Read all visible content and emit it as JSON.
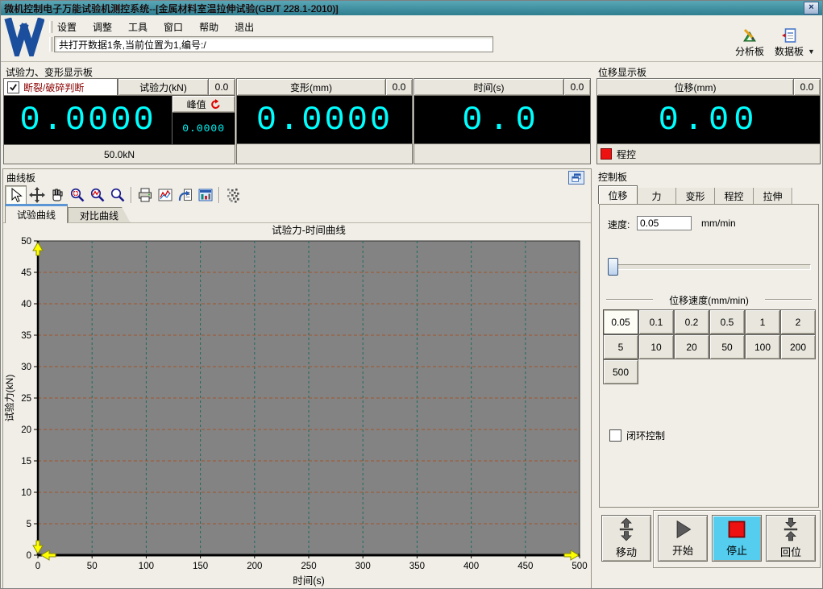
{
  "window": {
    "title": "微机控制电子万能试验机测控系统--[金属材料室温拉伸试验(GB/T 228.1-2010)]",
    "close_glyph": "×"
  },
  "menu": {
    "items": [
      "设置",
      "调整",
      "工具",
      "窗口",
      "帮助",
      "退出"
    ]
  },
  "statusbar": {
    "text": "共打开数据1条,当前位置为1,编号:/"
  },
  "topbar": {
    "analysis_label": "分析板",
    "data_label": "数据板",
    "dropdown_glyph": "▼"
  },
  "force_panel": {
    "header": "试验力、变形显示板",
    "break_check_label": "断裂/破碎判断",
    "break_checked": true,
    "force": {
      "button": "试验力(kN)",
      "aux_value": "0.0",
      "value": "0.0000",
      "peak_label": "峰值",
      "peak_value": "0.0000",
      "range": "50.0kN"
    },
    "deform": {
      "button": "变形(mm)",
      "aux_value": "0.0",
      "value": "0.0000"
    },
    "time": {
      "button": "时间(s)",
      "aux_value": "0.0",
      "value": "0.0"
    }
  },
  "disp_panel": {
    "header": "位移显示板",
    "button": "位移(mm)",
    "aux_value": "0.0",
    "value": "0.00",
    "mode_label": "程控"
  },
  "curve_panel": {
    "header": "曲线板",
    "toolbar_icons": [
      {
        "name": "select-cursor-icon",
        "pressed": true
      },
      {
        "name": "move-crosshair-icon",
        "pressed": false
      },
      {
        "name": "pan-hand-icon",
        "pressed": false
      },
      {
        "name": "zoom-rect-icon",
        "pressed": false
      },
      {
        "name": "zoom-curve-icon",
        "pressed": false
      },
      {
        "name": "zoom-icon",
        "pressed": false
      },
      {
        "name": "separator"
      },
      {
        "name": "print-icon",
        "pressed": false
      },
      {
        "name": "curve-style-icon",
        "pressed": false
      },
      {
        "name": "data-replay-icon",
        "pressed": false
      },
      {
        "name": "report-panel-icon",
        "pressed": false
      },
      {
        "name": "separator"
      },
      {
        "name": "bitmap-export-icon",
        "pressed": false
      }
    ],
    "tabs": [
      {
        "label": "试验曲线",
        "active": true
      },
      {
        "label": "对比曲线",
        "active": false
      }
    ]
  },
  "chart_data": {
    "type": "line",
    "title": "试验力-时间曲线",
    "xlabel": "时间(s)",
    "ylabel": "试验力(kN)",
    "xlim": [
      0,
      500
    ],
    "ylim": [
      0,
      50
    ],
    "x_ticks": [
      0,
      50,
      100,
      150,
      200,
      250,
      300,
      350,
      400,
      450,
      500
    ],
    "y_ticks": [
      0,
      5,
      10,
      15,
      20,
      25,
      30,
      35,
      40,
      45,
      50
    ],
    "grid": true,
    "legend": false,
    "series": [
      {
        "name": "试验力-时间",
        "x": [],
        "y": []
      }
    ]
  },
  "control_panel": {
    "header": "控制板",
    "tabs": [
      {
        "label": "位移",
        "active": true
      },
      {
        "label": "力",
        "active": false
      },
      {
        "label": "变形",
        "active": false
      },
      {
        "label": "程控",
        "active": false
      },
      {
        "label": "拉伸",
        "active": false
      }
    ],
    "speed_label": "速度:",
    "speed_value": "0.05",
    "speed_unit": "mm/min",
    "group_title": "位移速度(mm/min)",
    "speed_options": [
      "0.05",
      "0.1",
      "0.2",
      "0.5",
      "1",
      "2",
      "5",
      "10",
      "20",
      "50",
      "100",
      "200",
      "500"
    ],
    "selected_speed": "0.05",
    "closed_loop_label": "闭环控制",
    "closed_loop_checked": false,
    "buttons": {
      "move": "移动",
      "start": "开始",
      "stop": "停止",
      "home": "回位"
    }
  },
  "colors": {
    "titlebar": "#3b8ea1",
    "display_bg": "#000000",
    "display_text": "#00ffff",
    "alert_text": "#8b0000",
    "plot_bg": "#838383",
    "grid_h": "#a2562b",
    "grid_v": "#1e6a5f",
    "marker_yellow": "#ffff00",
    "stop_active_bg": "#55cdee",
    "stop_red": "#ee1111"
  }
}
